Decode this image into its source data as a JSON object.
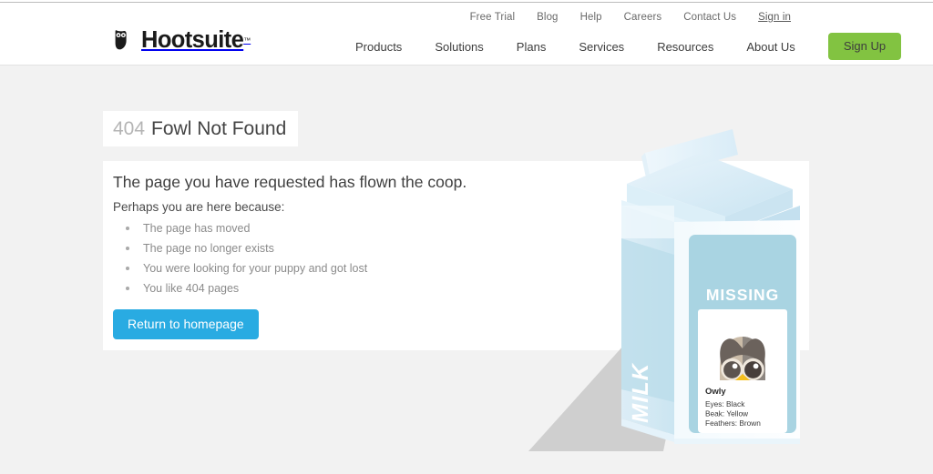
{
  "header": {
    "utility_nav": [
      {
        "label": "Free Trial",
        "style": "plain"
      },
      {
        "label": "Blog",
        "style": "plain"
      },
      {
        "label": "Help",
        "style": "plain"
      },
      {
        "label": "Careers",
        "style": "plain"
      },
      {
        "label": "Contact Us",
        "style": "plain"
      },
      {
        "label": "Sign in",
        "style": "underlined"
      }
    ],
    "logo": {
      "text": "Hootsuite",
      "trademark": "™",
      "icon": "owl-icon"
    },
    "main_nav": [
      {
        "label": "Products"
      },
      {
        "label": "Solutions"
      },
      {
        "label": "Plans"
      },
      {
        "label": "Services"
      },
      {
        "label": "Resources"
      },
      {
        "label": "About Us"
      }
    ],
    "signup_button": {
      "label": "Sign Up",
      "color": "#82c341"
    }
  },
  "error_page": {
    "code": "404",
    "title": "Fowl Not Found",
    "lead": "The page you have requested has flown the coop.",
    "subheading": "Perhaps you are here because:",
    "reasons": [
      "The page has moved",
      "The page no longer exists",
      "You were looking for your puppy and got lost",
      "You like 404 pages"
    ],
    "home_button": {
      "label": "Return to homepage",
      "color": "#29abe2"
    }
  },
  "illustration": {
    "name": "missing-owl-milk-carton",
    "side_label": "MILK",
    "poster_heading": "MISSING",
    "info_card": {
      "name": "Owly",
      "attributes": [
        "Eyes: Black",
        "Beak: Yellow",
        "Feathers: Brown"
      ]
    },
    "colors": {
      "carton_front": "#eef7fc",
      "carton_side": "#cde7f2",
      "poster_panel": "#a9d4e2",
      "owl_body": "#cbbca8",
      "owl_dark": "#6b625c",
      "beak": "#f5bf1e"
    }
  },
  "page": {
    "background": "#f2f2f2",
    "card_background": "#ffffff"
  }
}
